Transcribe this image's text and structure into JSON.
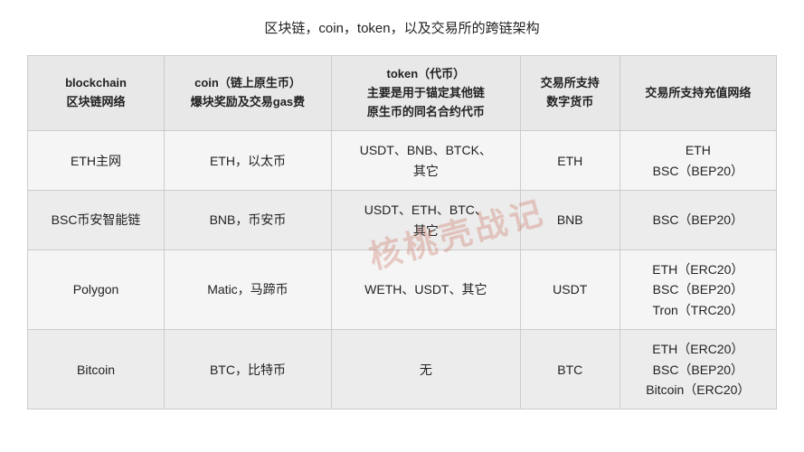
{
  "title": "区块链，coin，token，以及交易所的跨链架构",
  "watermark": "核桃壳战记",
  "table": {
    "headers": [
      "blockchain\n区块链网络",
      "coin（链上原生币）\n爆块奖励及交易gas费",
      "token（代币）\n主要是用于锚定其他链\n原生币的同名合约代币",
      "交易所支持\n数字货币",
      "交易所支持充值网络"
    ],
    "rows": [
      {
        "blockchain": "ETH主网",
        "coin": "ETH，以太币",
        "token": "USDT、BNB、BTCK、\n其它",
        "exchange_coin": "ETH",
        "networks": "ETH\nBSC（BEP20）"
      },
      {
        "blockchain": "BSC币安智能链",
        "coin": "BNB，币安币",
        "token": "USDT、ETH、BTC、\n其它",
        "exchange_coin": "BNB",
        "networks": "BSC（BEP20）"
      },
      {
        "blockchain": "Polygon",
        "coin": "Matic，马蹄币",
        "token": "WETH、USDT、其它",
        "exchange_coin": "USDT",
        "networks": "ETH（ERC20）\nBSC（BEP20）\nTron（TRC20）"
      },
      {
        "blockchain": "Bitcoin",
        "coin": "BTC，比特币",
        "token": "无",
        "exchange_coin": "BTC",
        "networks": "ETH（ERC20）\nBSC（BEP20）\nBitcoin（ERC20）"
      }
    ]
  }
}
